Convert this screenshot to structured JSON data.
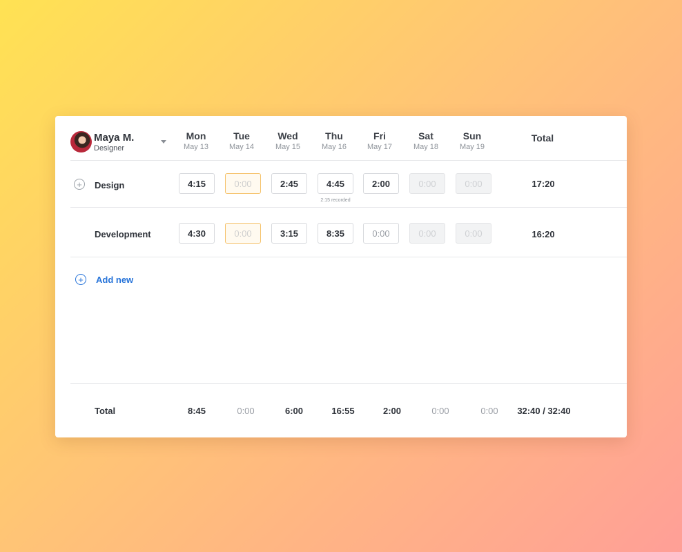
{
  "user": {
    "name": "Maya M.",
    "role": "Designer"
  },
  "days": [
    {
      "name": "Mon",
      "date": "May 13"
    },
    {
      "name": "Tue",
      "date": "May 14"
    },
    {
      "name": "Wed",
      "date": "May 15"
    },
    {
      "name": "Thu",
      "date": "May 16"
    },
    {
      "name": "Fri",
      "date": "May 17"
    },
    {
      "name": "Sat",
      "date": "May 18"
    },
    {
      "name": "Sun",
      "date": "May 19"
    }
  ],
  "total_label": "Total",
  "rows": [
    {
      "label": "Design",
      "cells": [
        "4:15",
        "0:00",
        "2:45",
        "4:45",
        "2:00",
        "0:00",
        "0:00"
      ],
      "total": "17:20",
      "note": "2:15 recorded"
    },
    {
      "label": "Development",
      "cells": [
        "4:30",
        "0:00",
        "3:15",
        "8:35",
        "0:00",
        "0:00",
        "0:00"
      ],
      "total": "16:20"
    }
  ],
  "add_new_label": "Add new",
  "footer": {
    "label": "Total",
    "values": [
      "8:45",
      "0:00",
      "6:00",
      "16:55",
      "2:00",
      "0:00",
      "0:00"
    ],
    "grand_total": "32:40 / 32:40"
  },
  "colors": {
    "accent": "#2673d9",
    "highlight_border": "#f5c26b"
  },
  "icons": {
    "row_add": "plus-circle-icon",
    "add_new": "plus-circle-icon",
    "dropdown": "caret-down-icon"
  }
}
